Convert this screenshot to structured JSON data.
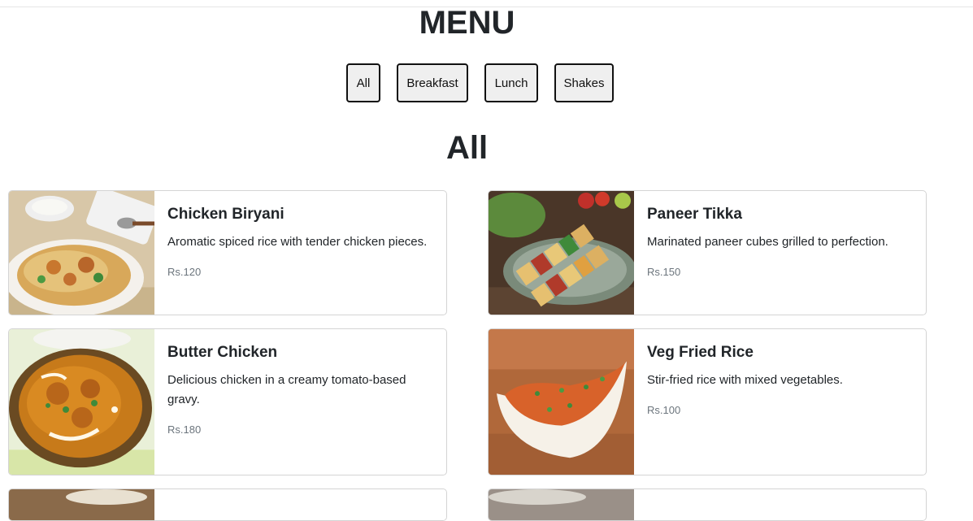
{
  "header": {
    "title": "MENU"
  },
  "filters": [
    {
      "label": "All"
    },
    {
      "label": "Breakfast"
    },
    {
      "label": "Lunch"
    },
    {
      "label": "Shakes"
    }
  ],
  "section": {
    "title": "All"
  },
  "items": [
    {
      "name": "Chicken Biryani",
      "description": "Aromatic spiced rice with tender chicken pieces.",
      "price": "Rs.120"
    },
    {
      "name": "Paneer Tikka",
      "description": "Marinated paneer cubes grilled to perfection.",
      "price": "Rs.150"
    },
    {
      "name": "Butter Chicken",
      "description": "Delicious chicken in a creamy tomato-based gravy.",
      "price": "Rs.180"
    },
    {
      "name": "Veg Fried Rice",
      "description": "Stir-fried rice with mixed vegetables.",
      "price": "Rs.100"
    }
  ]
}
